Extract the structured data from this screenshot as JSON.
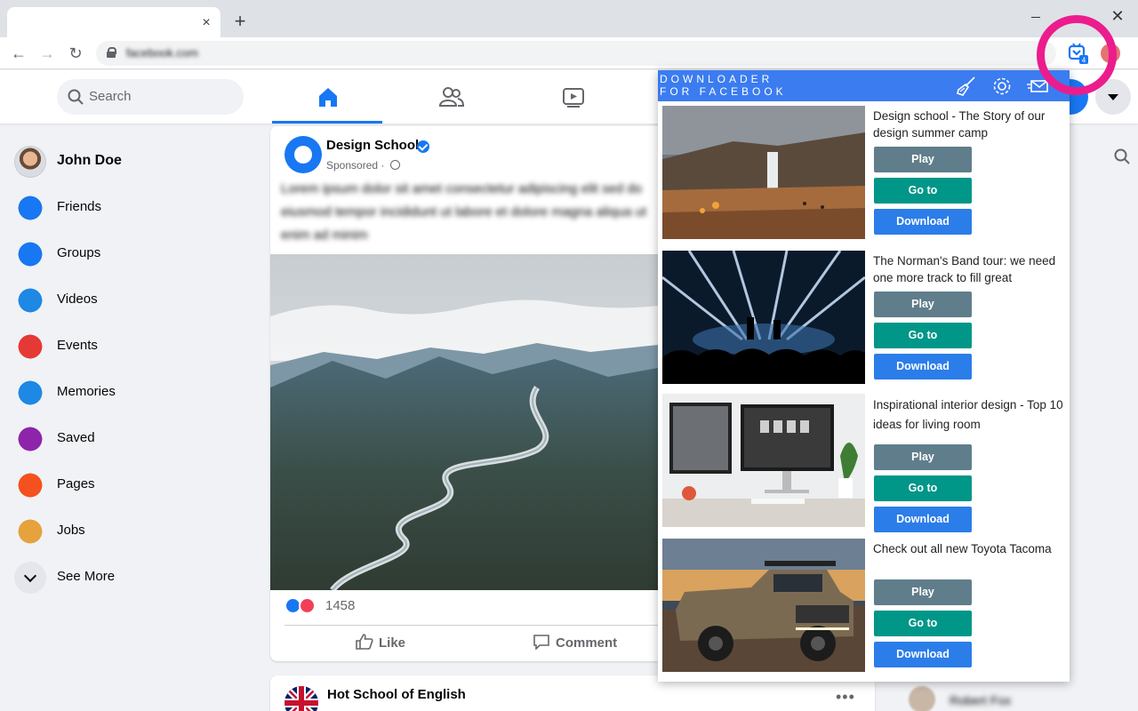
{
  "browser": {
    "url": "facebook.com",
    "tab_close": "×",
    "new_tab": "+",
    "window_close": "✕",
    "extension_badge": "4"
  },
  "facebook": {
    "search_placeholder": "Search",
    "sidebar": [
      {
        "label": "John Doe",
        "icon": "user-avatar",
        "color": "#c9a27e"
      },
      {
        "label": "Friends",
        "icon": "friends-icon",
        "color": "#1877f2"
      },
      {
        "label": "Groups",
        "icon": "groups-icon",
        "color": "#1877f2"
      },
      {
        "label": "Videos",
        "icon": "videos-icon",
        "color": "#1e88e5"
      },
      {
        "label": "Events",
        "icon": "events-icon",
        "color": "#e53935"
      },
      {
        "label": "Memories",
        "icon": "memories-icon",
        "color": "#1e88e5"
      },
      {
        "label": "Saved",
        "icon": "saved-icon",
        "color": "#8e24aa"
      },
      {
        "label": "Pages",
        "icon": "pages-icon",
        "color": "#f4511e"
      },
      {
        "label": "Jobs",
        "icon": "jobs-icon",
        "color": "#e6a23c"
      },
      {
        "label": "See More",
        "icon": "chevron-down-icon",
        "color": "#e4e6eb"
      }
    ],
    "post": {
      "author": "Design School",
      "meta": "Sponsored ·",
      "text": "Lorem ipsum dolor sit amet consectetur adipiscing elit sed do eiusmod tempor incididunt ut labore et dolore magna aliqua ut enim ad minim",
      "reaction_count": "1458",
      "like_label": "Like",
      "comment_label": "Comment"
    },
    "post2": {
      "author": "Hot School of English",
      "menu": "•••"
    },
    "contact": {
      "name": "Robert Fox"
    }
  },
  "extension": {
    "brand_line1": "DOWNLOADER",
    "brand_line2": "FOR FACEBOOK",
    "accent": "#3b7cf0",
    "highlight_color": "#ec1c8d",
    "items": [
      {
        "title": "Design school - The Story of our design summer camp",
        "play": "Play",
        "goto": "Go to",
        "download": "Download",
        "thumb": "waterfall-landscape"
      },
      {
        "title": "The Norman's Band tour: we need one more track to fill great",
        "play": "Play",
        "goto": "Go to",
        "download": "Download",
        "thumb": "concert-stage"
      },
      {
        "title": "Inspirational interior design - Top 10 ideas for living room",
        "play": "Play",
        "goto": "Go to",
        "download": "Download",
        "thumb": "desk-monitors"
      },
      {
        "title": "Check out all new Toyota Tacoma",
        "play": "Play",
        "goto": "Go to",
        "download": "Download",
        "thumb": "pickup-truck"
      }
    ]
  }
}
